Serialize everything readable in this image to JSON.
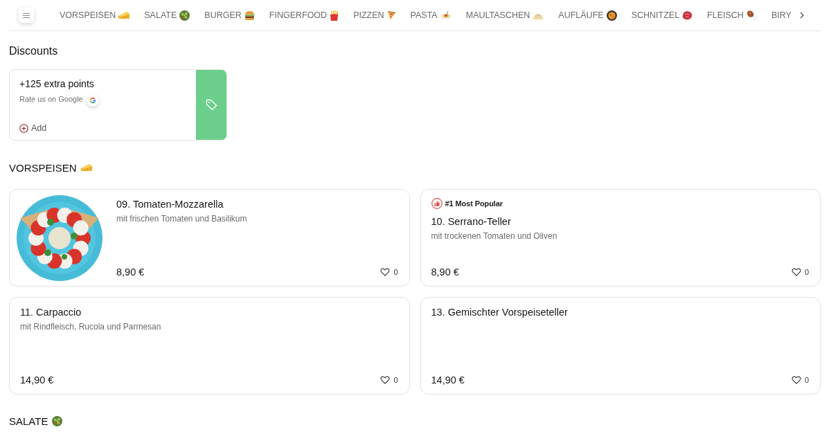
{
  "nav": {
    "categories": [
      "VORSPEISEN",
      "SALATE",
      "BURGER",
      "FINGERFOOD",
      "PIZZEN",
      "PASTA",
      "MAULTASCHEN",
      "AUFLÄUFE",
      "SCHNITZEL",
      "FLEISCH",
      "BIRY"
    ]
  },
  "discounts": {
    "title": "Discounts",
    "offers": [
      {
        "title": "+125 extra points",
        "subtitle": "Rate us on Google",
        "action": "Add"
      }
    ]
  },
  "sections": [
    {
      "title": "VORSPEISEN",
      "items": [
        {
          "name": "09. Tomaten-Mozzarella",
          "description": "mit frischen Tomaten und Basilikum",
          "price": "8,90 €",
          "likes": "0",
          "liked": false,
          "photo": true
        },
        {
          "badge": "#1 Most Popular",
          "name": "10. Serrano-Teller",
          "description": "mit trockenen Tomaten und Oliven",
          "price": "8,90 €",
          "likes": "0",
          "liked": false,
          "photo": false
        },
        {
          "name": "11. Carpaccio",
          "description": "mit Rindfleisch, Rucola und Parmesan",
          "price": "14,90 €",
          "likes": "0",
          "liked": false,
          "photo": false
        },
        {
          "name": "13. Gemischter Vorspeiseteller",
          "price": "14,90 €",
          "likes": "0",
          "liked": false,
          "photo": false
        }
      ]
    },
    {
      "title": "SALATE"
    }
  ]
}
